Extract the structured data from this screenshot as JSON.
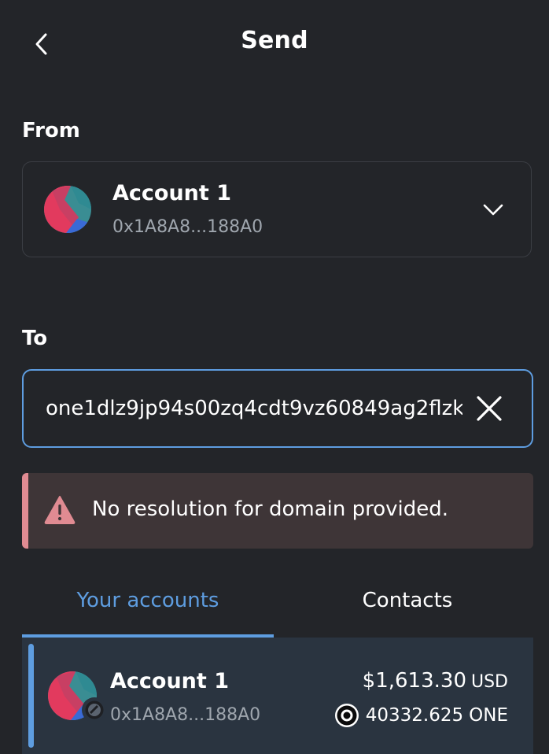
{
  "header": {
    "title": "Send",
    "back_icon": "chevron-left-icon"
  },
  "from": {
    "label": "From",
    "account_name": "Account 1",
    "account_address": "0x1A8A8...188A0",
    "dropdown_icon": "chevron-down-icon"
  },
  "to": {
    "label": "To",
    "value": "one1dlz9jp94s00zq4cdt9vz60849ag2flzk",
    "clear_icon": "close-icon"
  },
  "error": {
    "icon": "warning-icon",
    "message": "No resolution for domain provided."
  },
  "tabs": {
    "your_accounts": "Your accounts",
    "contacts": "Contacts",
    "active": "your_accounts"
  },
  "account_list": [
    {
      "name": "Account 1",
      "address": "0x1A8A8...188A0",
      "fiat_balance": "$1,613.30",
      "fiat_currency": "USD",
      "token_amount": "40332.625",
      "token_symbol": "ONE",
      "selected": true
    }
  ],
  "colors": {
    "background": "#232529",
    "accent": "#5e9de0",
    "error_accent": "#e08b92",
    "error_background": "#3e3537",
    "selected_row": "#2a3440",
    "muted_text": "#9fa6ae"
  }
}
